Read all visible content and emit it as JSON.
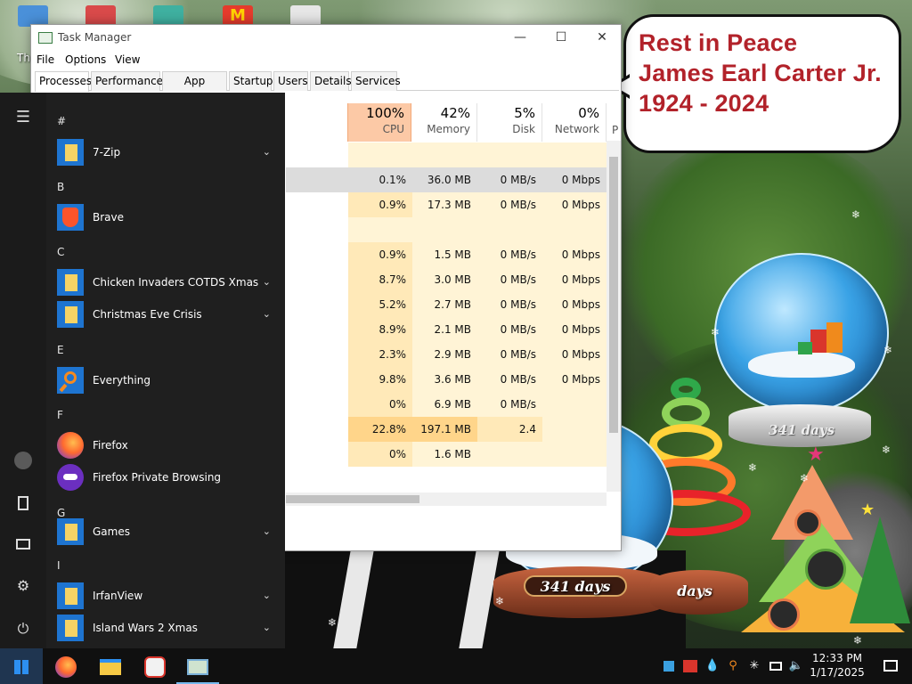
{
  "desktop": {
    "partial_icon_label": "Th",
    "bubble_lines": [
      "Rest in Peace",
      "James Earl Carter Jr.",
      "1924 - 2024"
    ],
    "globe_plaques": [
      "341 days",
      "341 days",
      "days"
    ]
  },
  "task_manager": {
    "title": "Task Manager",
    "window_controls": {
      "minimize": "—",
      "maximize": "☐",
      "close": "✕"
    },
    "menu": [
      "File",
      "Options",
      "View"
    ],
    "tabs": [
      "Processes",
      "Performance",
      "App history",
      "Startup",
      "Users",
      "Details",
      "Services"
    ],
    "active_tab": "Processes",
    "columns": [
      {
        "pct": "100%",
        "label": "CPU"
      },
      {
        "pct": "42%",
        "label": "Memory"
      },
      {
        "pct": "5%",
        "label": "Disk"
      },
      {
        "pct": "0%",
        "label": "Network"
      }
    ],
    "partial_column_letter": "P",
    "rows": [
      {
        "cpu": "",
        "mem": "",
        "disk": "",
        "net": ""
      },
      {
        "cpu": "0.1%",
        "mem": "36.0 MB",
        "disk": "0 MB/s",
        "net": "0 Mbps"
      },
      {
        "cpu": "0.9%",
        "mem": "17.3 MB",
        "disk": "0 MB/s",
        "net": "0 Mbps"
      },
      {
        "cpu": "",
        "mem": "",
        "disk": "",
        "net": ""
      },
      {
        "cpu": "0.9%",
        "mem": "1.5 MB",
        "disk": "0 MB/s",
        "net": "0 Mbps"
      },
      {
        "cpu": "8.7%",
        "mem": "3.0 MB",
        "disk": "0 MB/s",
        "net": "0 Mbps"
      },
      {
        "cpu": "5.2%",
        "mem": "2.7 MB",
        "disk": "0 MB/s",
        "net": "0 Mbps"
      },
      {
        "cpu": "8.9%",
        "mem": "2.1 MB",
        "disk": "0 MB/s",
        "net": "0 Mbps"
      },
      {
        "cpu": "2.3%",
        "mem": "2.9 MB",
        "disk": "0 MB/s",
        "net": "0 Mbps"
      },
      {
        "cpu": "9.8%",
        "mem": "3.6 MB",
        "disk": "0 MB/s",
        "net": "0 Mbps"
      },
      {
        "cpu": "0%",
        "mem": "6.9 MB",
        "disk": "0 MB/s",
        "net": ""
      },
      {
        "cpu": "22.8%",
        "mem": "197.1 MB",
        "disk": "2.4",
        "net": ""
      },
      {
        "cpu": "0%",
        "mem": "1.6 MB",
        "disk": "",
        "net": ""
      }
    ]
  },
  "start_menu": {
    "rail": [
      "☰",
      "user",
      "documents",
      "pictures",
      "settings",
      "power"
    ],
    "letters": [
      "#",
      "B",
      "C",
      "E",
      "F",
      "G",
      "I"
    ],
    "apps": [
      {
        "name": "7-Zip",
        "icon": "folder-icon",
        "expandable": true
      },
      {
        "name": "Brave",
        "icon": "brave-icon",
        "expandable": false
      },
      {
        "name": "Chicken Invaders COTDS Xmas",
        "icon": "folder-icon",
        "expandable": true
      },
      {
        "name": "Christmas Eve Crisis",
        "icon": "folder-icon",
        "expandable": true
      },
      {
        "name": "Everything",
        "icon": "everything-search-icon",
        "expandable": false
      },
      {
        "name": "Firefox",
        "icon": "firefox-icon",
        "expandable": false
      },
      {
        "name": "Firefox Private Browsing",
        "icon": "firefox-private-icon",
        "expandable": false
      },
      {
        "name": "Games",
        "icon": "folder-icon",
        "expandable": true
      },
      {
        "name": "IrfanView",
        "icon": "folder-icon",
        "expandable": true
      },
      {
        "name": "Island Wars 2 Xmas",
        "icon": "folder-icon",
        "expandable": true
      }
    ],
    "chevron": "⌄"
  },
  "taskbar": {
    "pinned": [
      "start-icon",
      "firefox-icon",
      "file-explorer-icon",
      "chicken-invaders-icon",
      "task-manager-icon"
    ],
    "tray": [
      "blue-square-icon",
      "app-tray-icon",
      "drop-icon",
      "search-tray-icon",
      "snowflake-tray-icon",
      "network-icon",
      "volume-icon"
    ],
    "time": "12:33 PM",
    "date": "1/17/2025"
  },
  "colors": {
    "cpu_header": "#fcc9a6",
    "heat_light": "#fff4d6",
    "heat_med": "#ffe9b8",
    "heat_high": "#ffd58a",
    "bubble_text": "#b2222a",
    "start_bg": "#1f1f1f",
    "taskbar_bg": "#101010"
  }
}
